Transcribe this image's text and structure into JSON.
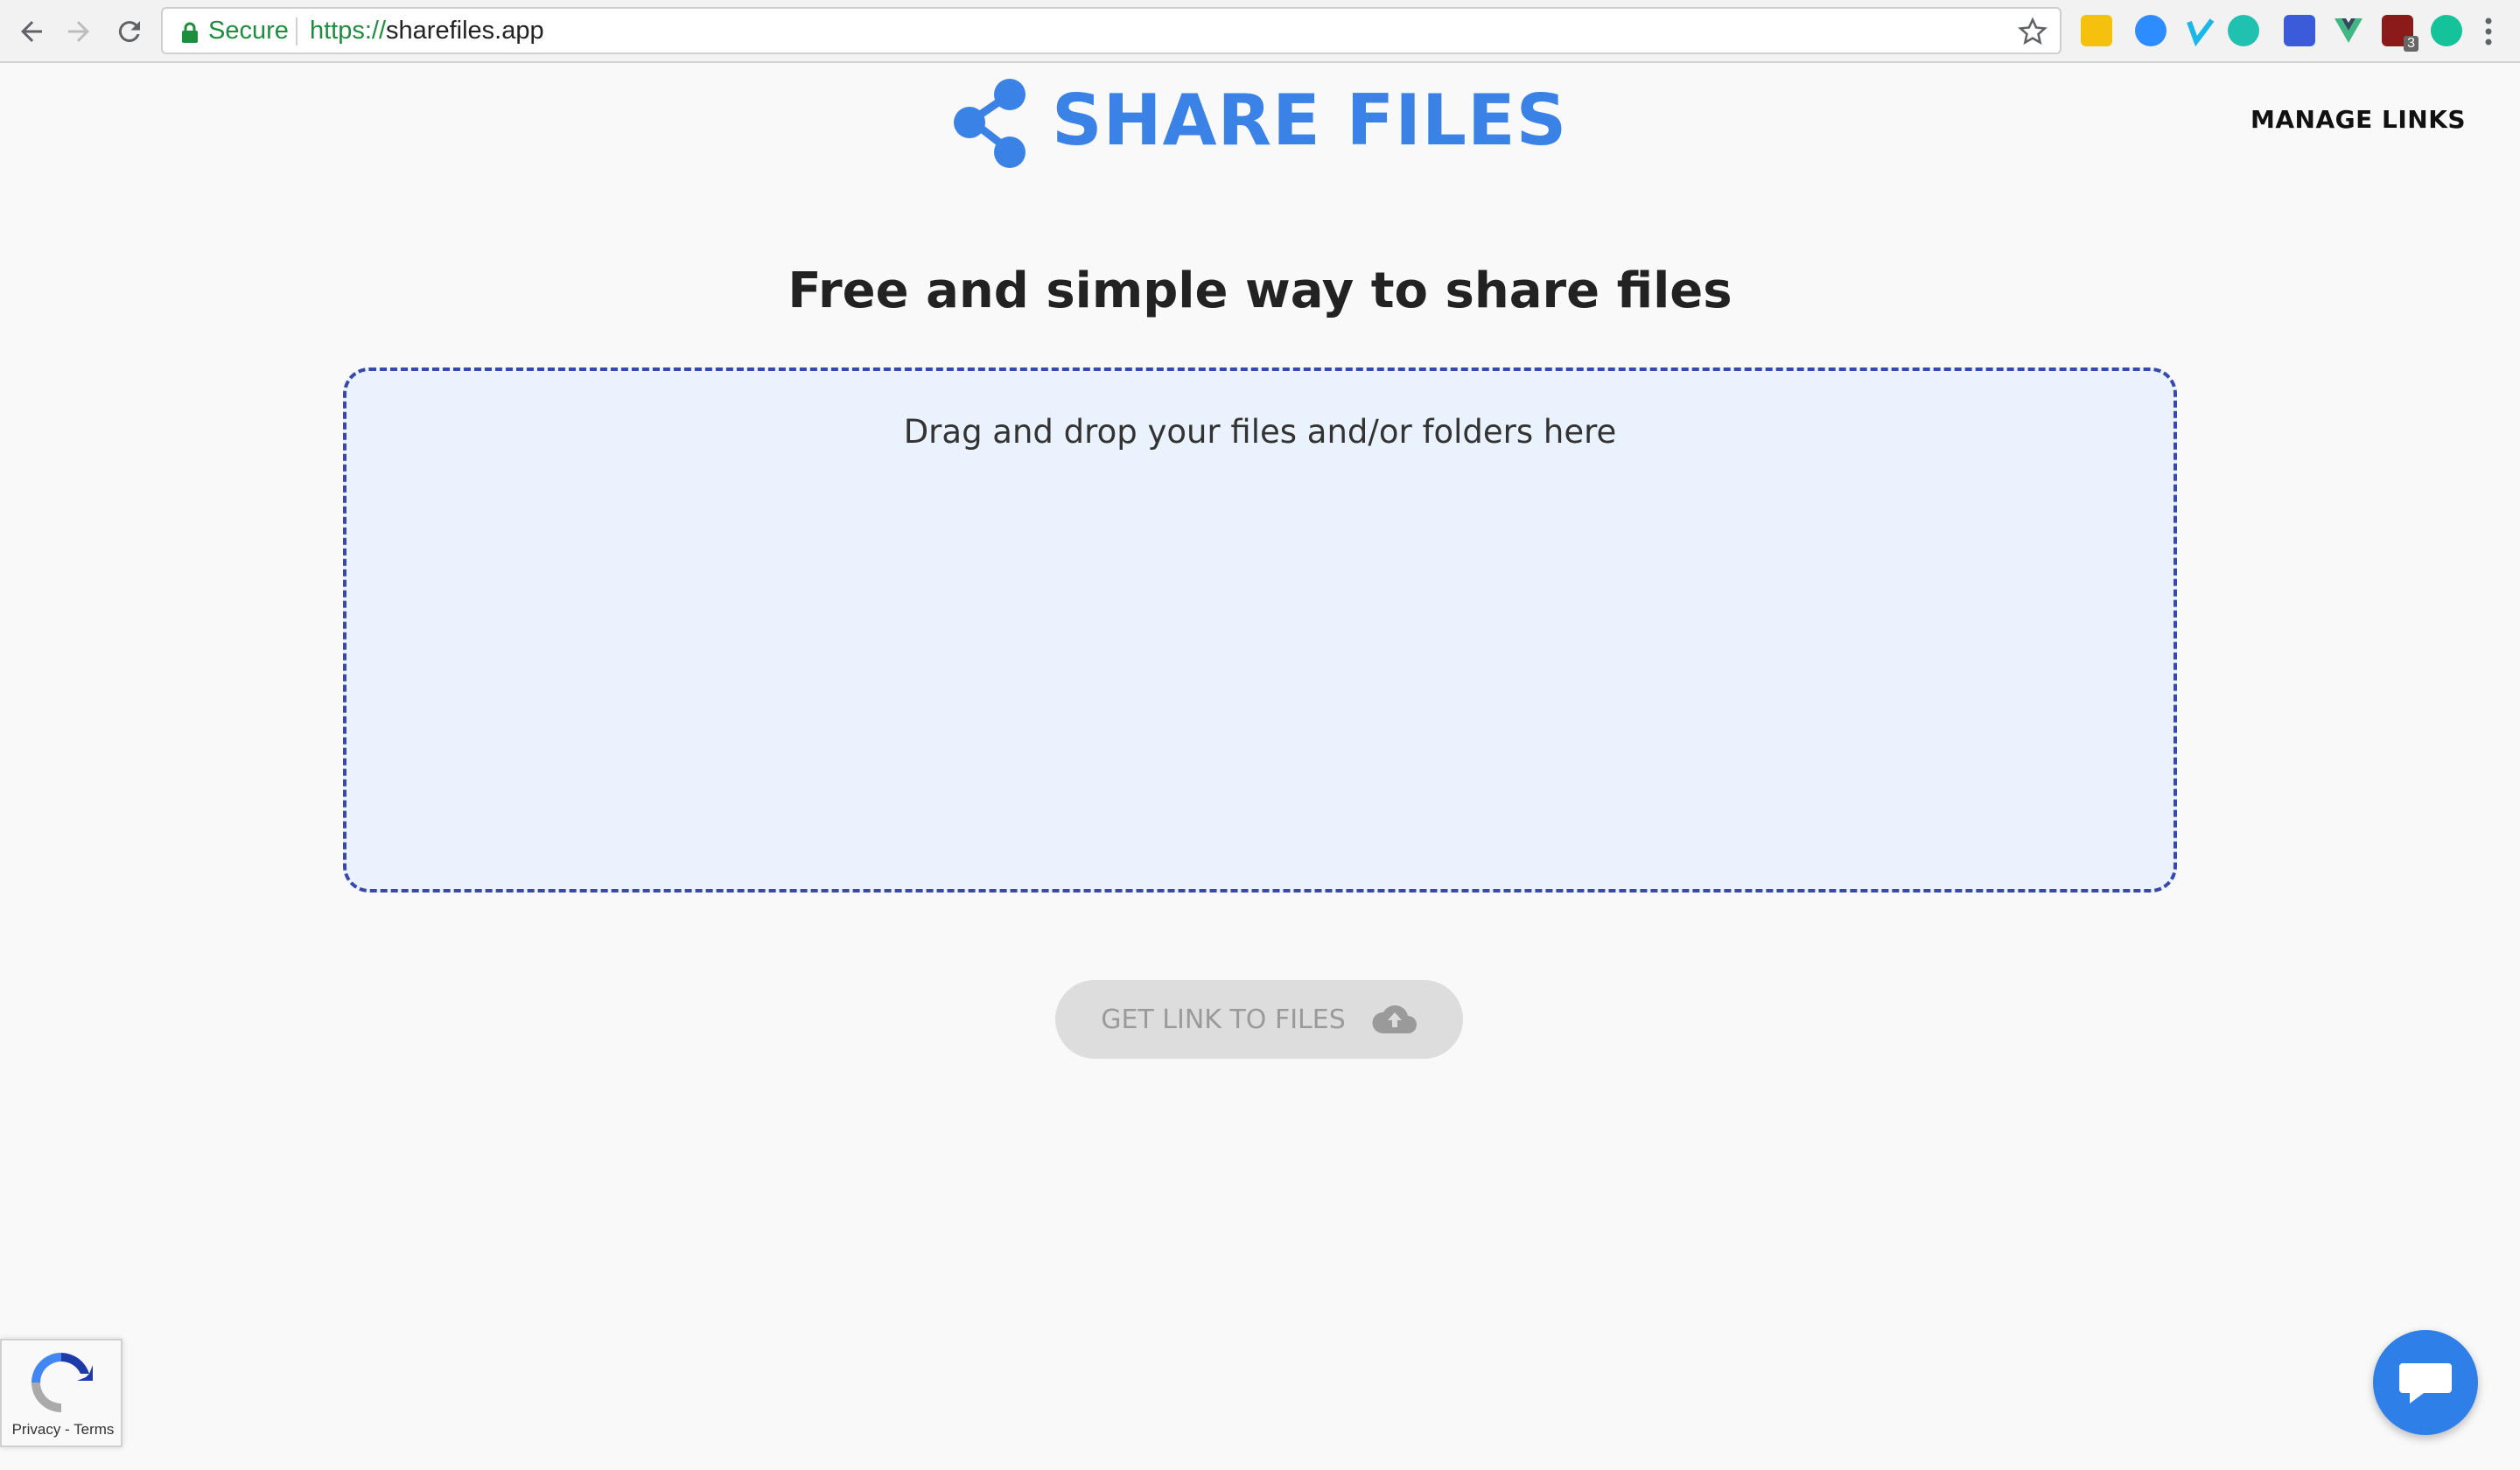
{
  "browser": {
    "secure_label": "Secure",
    "url_scheme": "https://",
    "url_host": "sharefiles.app",
    "extension_badge": "3",
    "extensions": [
      "keep-icon",
      "zoom-icon",
      "vimeo-icon",
      "meet-icon",
      "bookmark-icon",
      "vue-icon",
      "ublock-icon",
      "grammarly-icon"
    ]
  },
  "header": {
    "brand": "SHARE FILES",
    "manage_links": "MANAGE LINKS",
    "logo_icon": "share-icon"
  },
  "main": {
    "headline": "Free and simple way to share files",
    "dropzone_text": "Drag and drop your files and/or folders here",
    "get_link_label": "GET LINK TO FILES",
    "get_link_icon": "cloud-upload-icon"
  },
  "recaptcha": {
    "links": "Privacy - Terms"
  },
  "chat": {
    "icon": "chat-bubble-icon"
  },
  "colors": {
    "brand": "#3b82e6",
    "dropzone_bg": "#eaf3fd",
    "dropzone_border": "#3949ab",
    "button_disabled": "#dddddd",
    "chat": "#2f7fe8"
  }
}
